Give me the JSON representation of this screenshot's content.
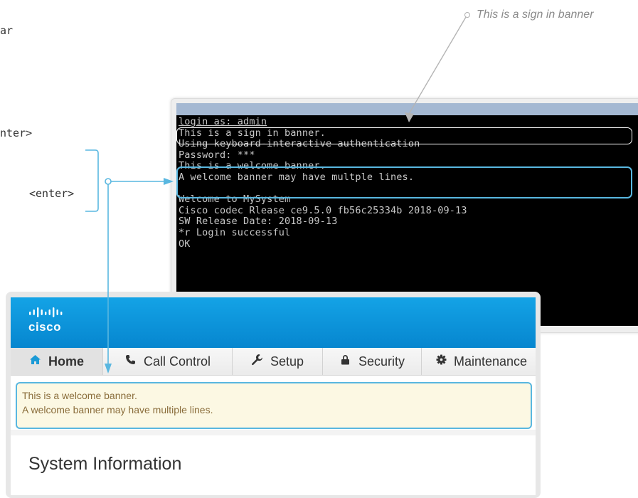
{
  "left_commands": {
    "line1": "ar",
    "line2": "nter>",
    "line3": "<enter>"
  },
  "callout": {
    "text": "This is a sign in banner"
  },
  "terminal": {
    "lines": [
      "login as: admin",
      "This is a sign in banner.",
      "Using keyboard-interactive authentication",
      "Password: ***",
      "This is a welcome banner.",
      "A welcome banner may have multple lines.",
      "",
      "Welcome to MySystem",
      "Cisco codec Rlease ce9.5.0 fb56c25334b 2018-09-13",
      "SW Release Date: 2018-09-13",
      "*r Login successful",
      "OK"
    ]
  },
  "web": {
    "brand": "cisco",
    "nav": [
      {
        "label": "Home",
        "icon": "home-icon",
        "active": true
      },
      {
        "label": "Call Control",
        "icon": "phone-icon",
        "active": false
      },
      {
        "label": "Setup",
        "icon": "wrench-icon",
        "active": false
      },
      {
        "label": "Security",
        "icon": "lock-icon",
        "active": false
      },
      {
        "label": "Maintenance",
        "icon": "gear-icon",
        "active": false
      }
    ],
    "banner": {
      "line1": "This is a welcome banner.",
      "line2": "A welcome banner may have multiple lines."
    },
    "page_title": "System Information"
  },
  "colors": {
    "accent_blue": "#59b7e0",
    "header_blue": "#0a93d8",
    "terminal_bg": "#000000",
    "banner_bg": "#fcf8e3"
  }
}
